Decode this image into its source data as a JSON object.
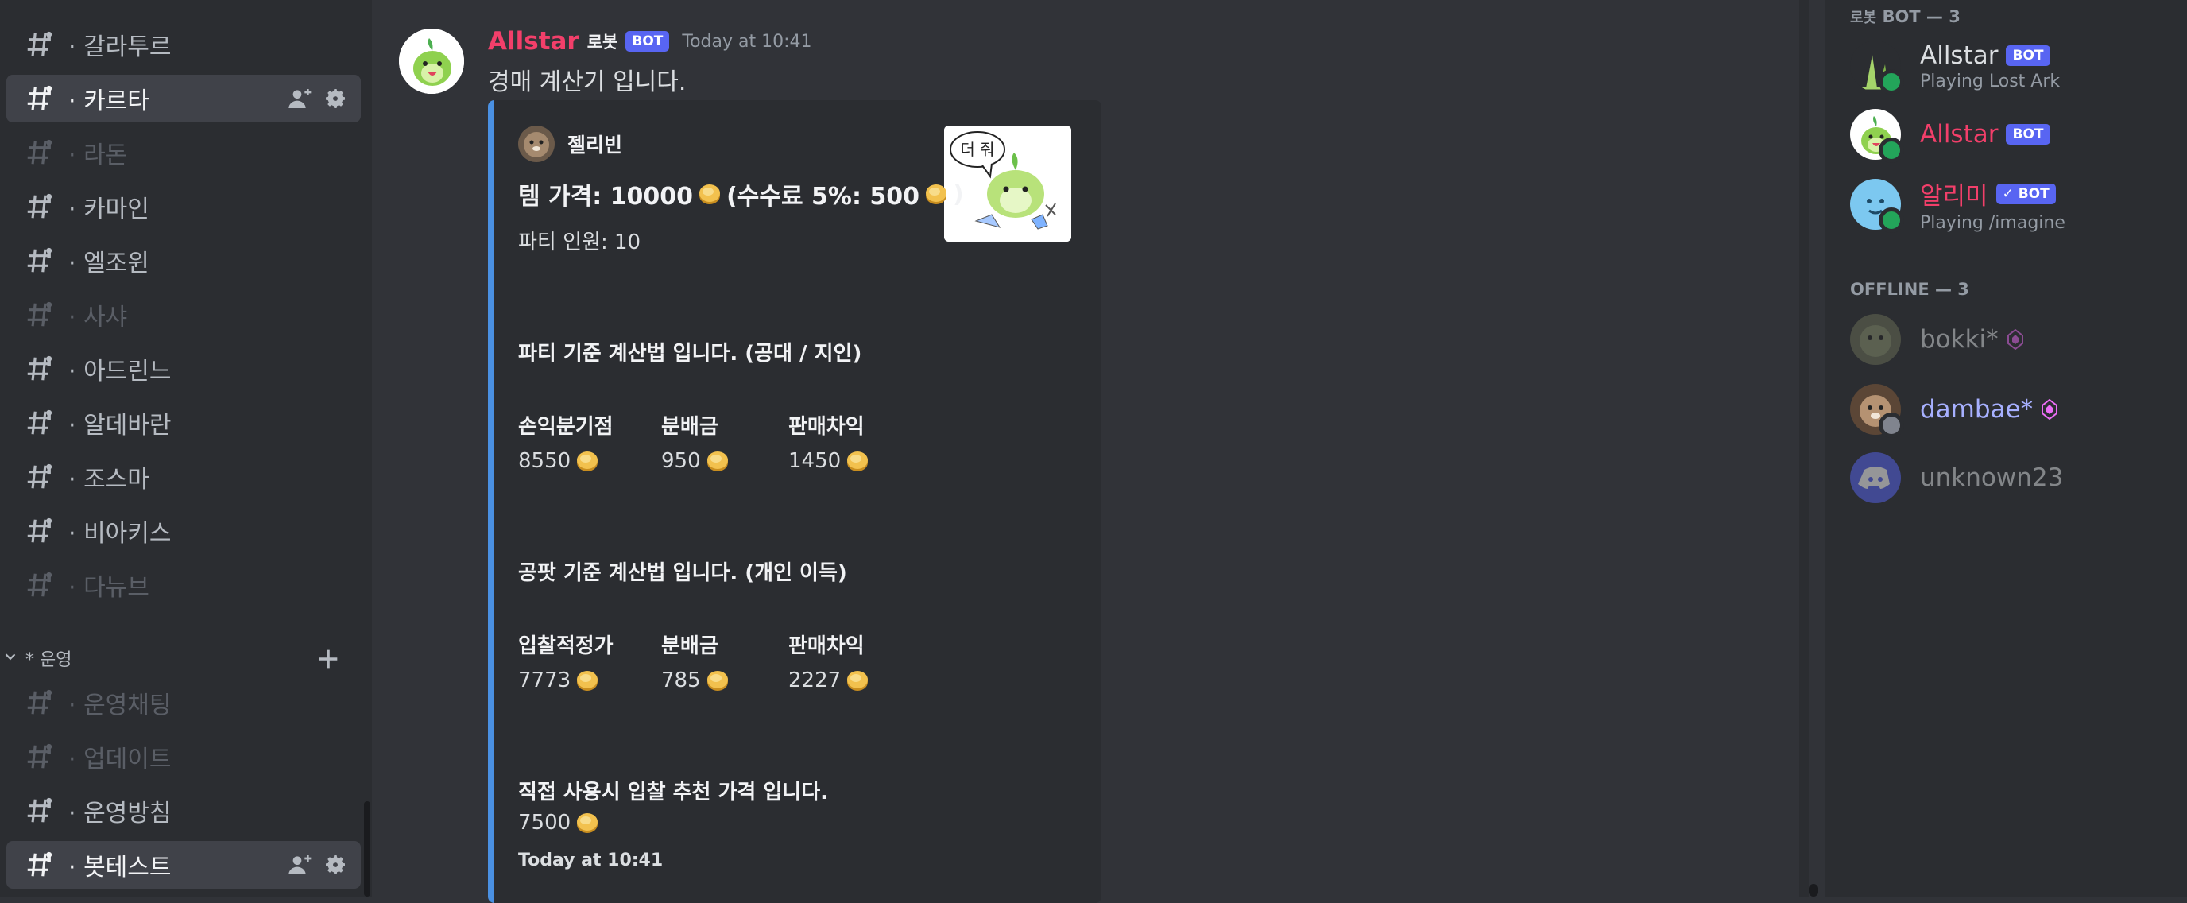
{
  "sidebar": {
    "channels": [
      {
        "name": "· 갈라투르",
        "state": "normal"
      },
      {
        "name": "· 카르타",
        "state": "active"
      },
      {
        "name": "· 라돈",
        "state": "dim"
      },
      {
        "name": "· 카마인",
        "state": "normal"
      },
      {
        "name": "· 엘조윈",
        "state": "normal"
      },
      {
        "name": "· 사샤",
        "state": "dim"
      },
      {
        "name": "· 아드린느",
        "state": "normal"
      },
      {
        "name": "· 알데바란",
        "state": "normal"
      },
      {
        "name": "· 조스마",
        "state": "normal"
      },
      {
        "name": "· 비아키스",
        "state": "normal"
      },
      {
        "name": "· 다뉴브",
        "state": "dim"
      }
    ],
    "category": {
      "label": "* 운영"
    },
    "category_channels": [
      {
        "name": "· 운영채팅",
        "state": "dim"
      },
      {
        "name": "· 업데이트",
        "state": "dim"
      },
      {
        "name": "· 운영방침",
        "state": "normal"
      },
      {
        "name": "· 봇테스트",
        "state": "active"
      }
    ]
  },
  "message": {
    "author": "Allstar",
    "role": "로봇",
    "bot_tag": "BOT",
    "timestamp": "Today at 10:41",
    "text": "경매 계산기 입니다.",
    "embed": {
      "author": "젤리빈",
      "thumbnail_text": "더 줘",
      "title_part1": "템 가격: 10000",
      "title_part2": "(수수료 5%: 500",
      "title_part3": ")",
      "party_members": "파티 인원: 10",
      "section1_title": "파티 기준 계산법 입니다. (공대 / 지인)",
      "section1_fields": [
        {
          "name": "손익분기점",
          "value": "8550"
        },
        {
          "name": "분배금",
          "value": "950"
        },
        {
          "name": "판매차익",
          "value": "1450"
        }
      ],
      "section2_title": "공팟 기준 계산법 입니다. (개인 이득)",
      "section2_fields": [
        {
          "name": "입찰적정가",
          "value": "7773"
        },
        {
          "name": "분배금",
          "value": "785"
        },
        {
          "name": "판매차익",
          "value": "2227"
        }
      ],
      "section3_title": "직접 사용시 입찰 추천 가격 입니다.",
      "section3_value": "7500",
      "footer": "Today at 10:41",
      "accent_color": "#4a90e2"
    }
  },
  "members": {
    "bot_group_prefix": "로봇",
    "bot_group_label": "BOT — 3",
    "bots": [
      {
        "name": "Allstar",
        "tag": "BOT",
        "activity": "Playing Lost Ark",
        "color": "#dbdee1"
      },
      {
        "name": "Allstar",
        "tag": "BOT",
        "activity": "",
        "color": "#f23f6a"
      },
      {
        "name": "알리미",
        "tag": "✓ BOT",
        "activity": "Playing /imagine",
        "color": "#f23f6a"
      }
    ],
    "offline_label": "OFFLINE — 3",
    "offline": [
      {
        "name": "bokki*"
      },
      {
        "name": "dambae*"
      },
      {
        "name": "unknown23"
      }
    ]
  },
  "colors": {
    "brand": "#5865f2",
    "online": "#23a55a",
    "author_red": "#f23f6a"
  }
}
